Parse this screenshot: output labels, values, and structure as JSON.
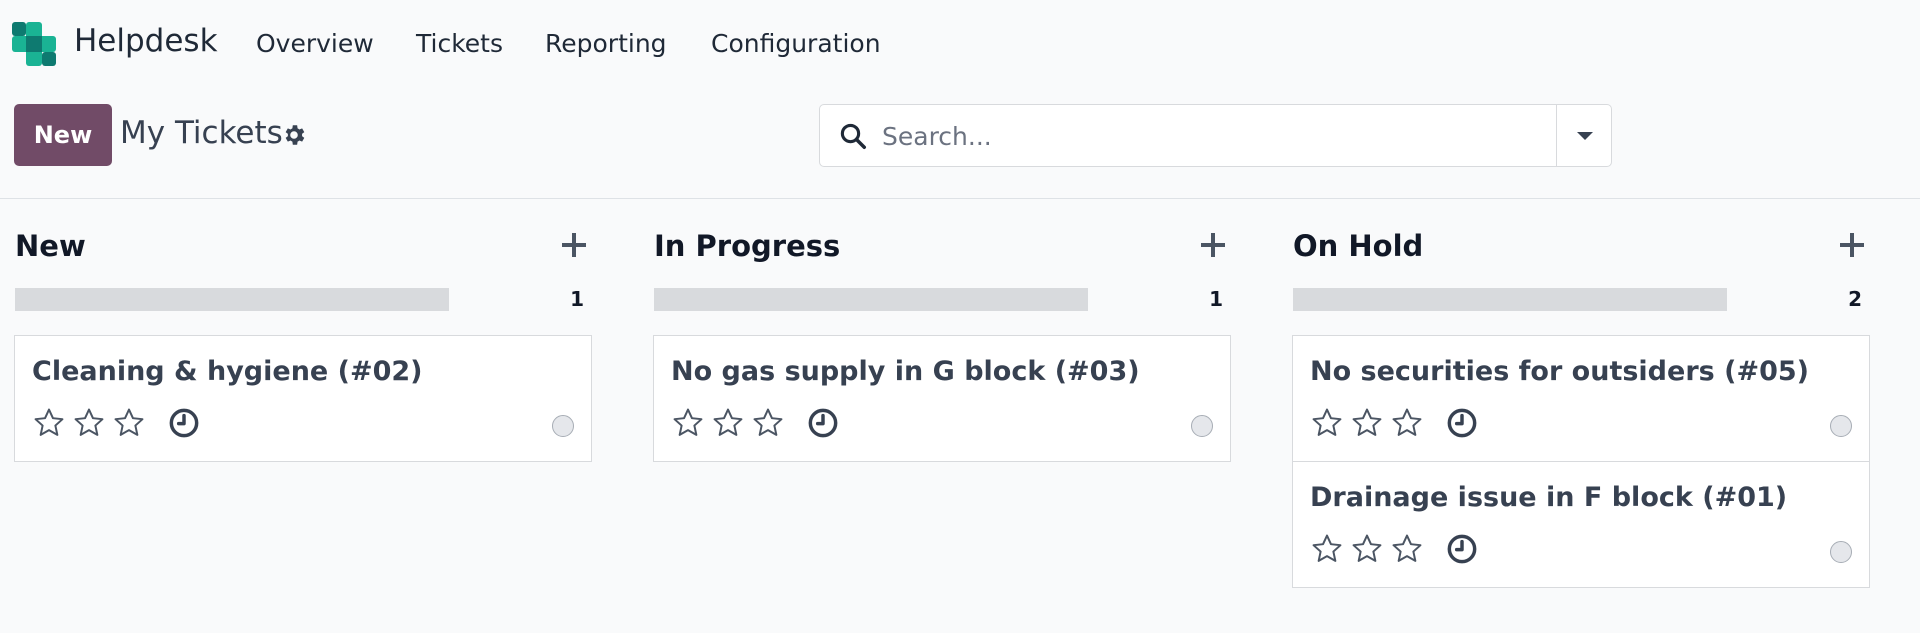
{
  "navbar": {
    "app_name": "Helpdesk",
    "menu": [
      "Overview",
      "Tickets",
      "Reporting",
      "Configuration"
    ]
  },
  "control_panel": {
    "new_label": "New",
    "view_title": "My Tickets",
    "search": {
      "placeholder": "Search...",
      "value": ""
    }
  },
  "colors": {
    "primary": "#714b67",
    "logo_teal": "#1ab394",
    "logo_dark": "#0e7a70"
  },
  "columns": [
    {
      "title": "New",
      "count": "1",
      "cards": [
        {
          "title": "Cleaning & hygiene (#02)",
          "priority": 0
        }
      ]
    },
    {
      "title": "In Progress",
      "count": "1",
      "cards": [
        {
          "title": "No gas supply in G block (#03)",
          "priority": 0
        }
      ]
    },
    {
      "title": "On Hold",
      "count": "2",
      "cards": [
        {
          "title": "No securities for outsiders (#05)",
          "priority": 0
        },
        {
          "title": "Drainage issue in F block (#01)",
          "priority": 0
        }
      ]
    }
  ],
  "icons": {
    "card": [
      "star-icon",
      "clock-icon",
      "status-dot"
    ],
    "header": [
      "app-logo",
      "gear-icon",
      "search-icon",
      "caret-down-icon",
      "plus-icon"
    ]
  }
}
